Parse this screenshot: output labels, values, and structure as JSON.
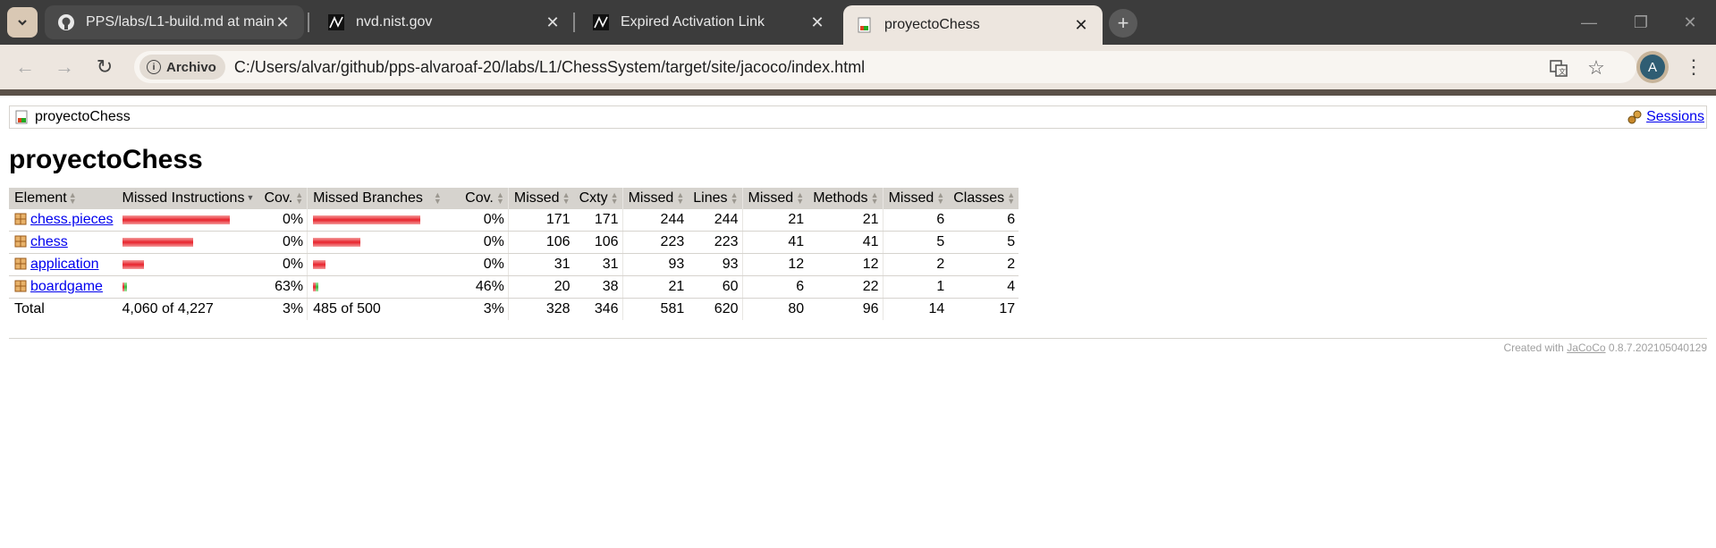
{
  "browser": {
    "tabs": [
      {
        "title": "PPS/labs/L1-build.md at main ·",
        "favicon": "github-icon"
      },
      {
        "title": "nvd.nist.gov",
        "favicon": "nvd-icon"
      },
      {
        "title": "Expired Activation Link",
        "favicon": "nvd-icon"
      },
      {
        "title": "proyectoChess",
        "favicon": "jacoco-report-icon",
        "active": true
      }
    ],
    "chip_label": "Archivo",
    "url": "C:/Users/alvar/github/pps-alvaroaf-20/labs/L1/ChessSystem/target/site/jacoco/index.html",
    "avatar_letter": "A",
    "colors": {
      "tabstrip": "#3c3c3c",
      "toolbar": "#ede6df"
    }
  },
  "breadcrumb": {
    "label": "proyectoChess",
    "sessions_label": "Sessions"
  },
  "page_title": "proyectoChess",
  "table": {
    "headers": [
      "Element",
      "Missed Instructions",
      "Cov.",
      "Missed Branches",
      "Cov.",
      "Missed",
      "Cxty",
      "Missed",
      "Lines",
      "Missed",
      "Methods",
      "Missed",
      "Classes"
    ],
    "rows": [
      {
        "name": "chess.pieces",
        "instr_cov": "0%",
        "instr_cov_fraction": 0.0,
        "instr_missed_fraction": 1.0,
        "branch_cov": "0%",
        "branch_cov_fraction": 0.0,
        "branch_missed_fraction": 1.0,
        "cxty_missed": "171",
        "cxty": "171",
        "lines_missed": "244",
        "lines": "244",
        "methods_missed": "21",
        "methods": "21",
        "classes_missed": "6",
        "classes": "6"
      },
      {
        "name": "chess",
        "instr_cov": "0%",
        "instr_cov_fraction": 0.0,
        "instr_missed_fraction": 0.66,
        "branch_cov": "0%",
        "branch_cov_fraction": 0.0,
        "branch_missed_fraction": 0.44,
        "cxty_missed": "106",
        "cxty": "106",
        "lines_missed": "223",
        "lines": "223",
        "methods_missed": "41",
        "methods": "41",
        "classes_missed": "5",
        "classes": "5"
      },
      {
        "name": "application",
        "instr_cov": "0%",
        "instr_cov_fraction": 0.0,
        "instr_missed_fraction": 0.2,
        "branch_cov": "0%",
        "branch_cov_fraction": 0.0,
        "branch_missed_fraction": 0.12,
        "cxty_missed": "31",
        "cxty": "31",
        "lines_missed": "93",
        "lines": "93",
        "methods_missed": "12",
        "methods": "12",
        "classes_missed": "2",
        "classes": "2"
      },
      {
        "name": "boardgame",
        "instr_cov": "63%",
        "instr_cov_fraction": 0.63,
        "instr_missed_fraction": 0.045,
        "branch_cov": "46%",
        "branch_cov_fraction": 0.46,
        "branch_missed_fraction": 0.05,
        "cxty_missed": "20",
        "cxty": "38",
        "lines_missed": "21",
        "lines": "60",
        "methods_missed": "6",
        "methods": "22",
        "classes_missed": "1",
        "classes": "4"
      }
    ],
    "total": {
      "label": "Total",
      "instr": "4,060 of 4,227",
      "instr_cov": "3%",
      "branch": "485 of 500",
      "branch_cov": "3%",
      "cxty_missed": "328",
      "cxty": "346",
      "lines_missed": "581",
      "lines": "620",
      "methods_missed": "80",
      "methods": "96",
      "classes_missed": "14",
      "classes": "17"
    }
  },
  "footer": {
    "prefix": "Created with",
    "link": "JaCoCo",
    "version": "0.8.7.202105040129"
  }
}
